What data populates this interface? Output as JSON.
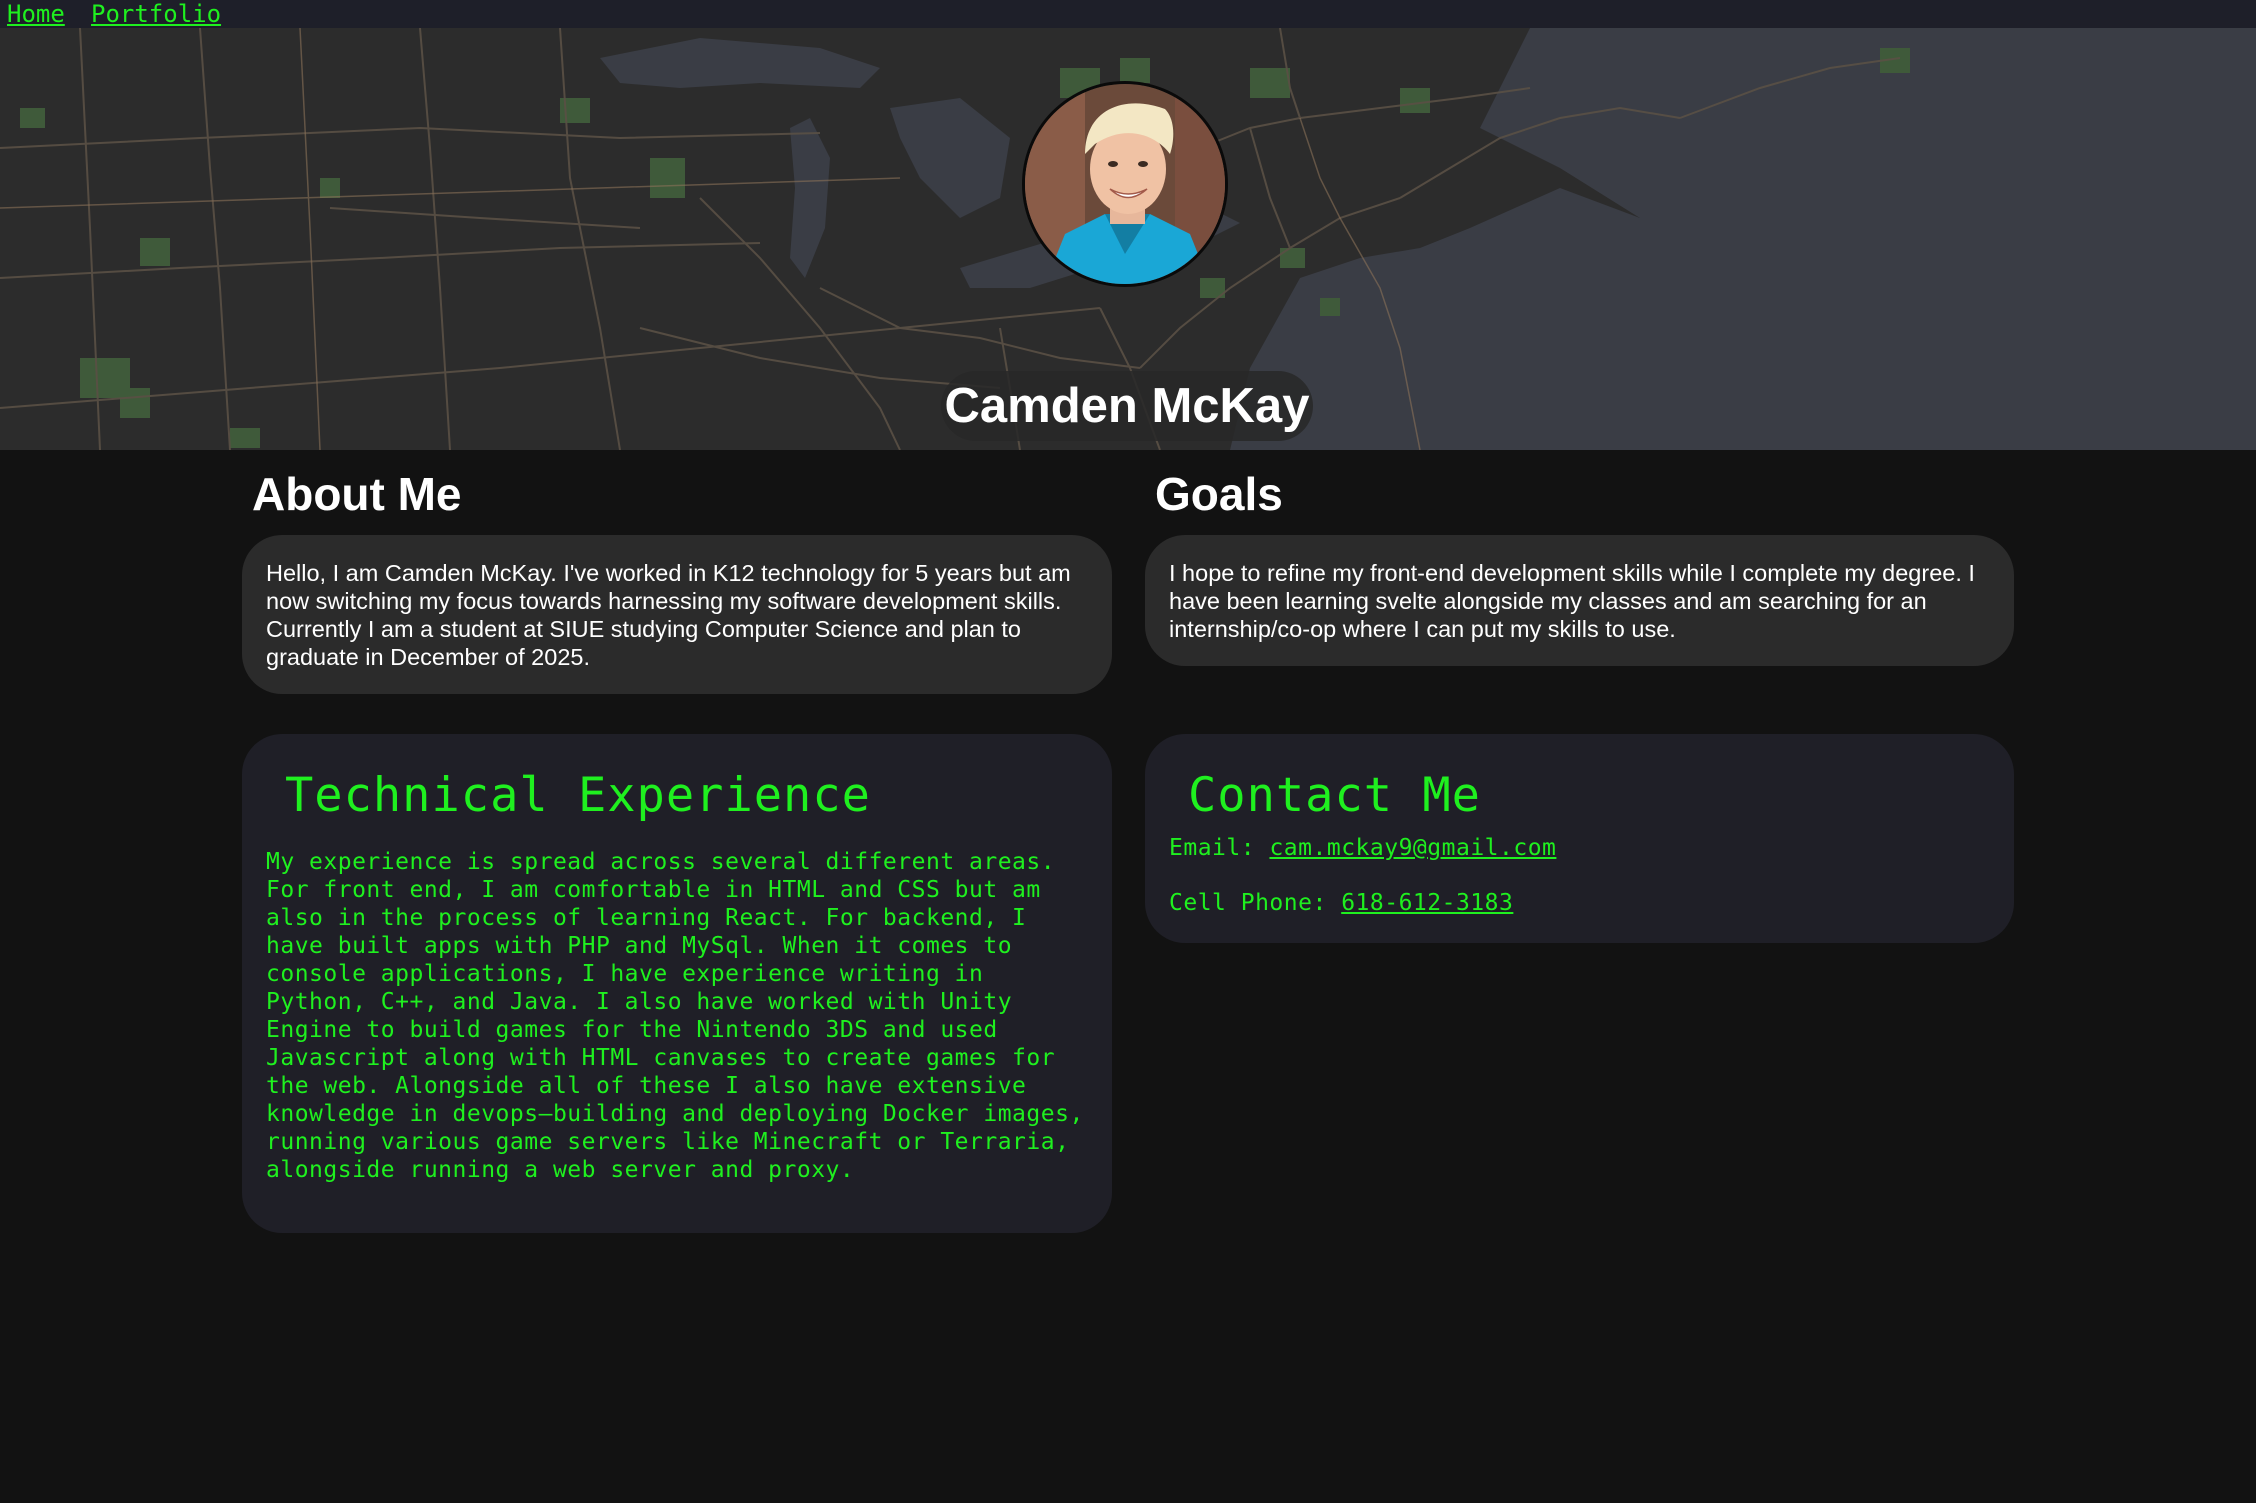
{
  "nav": {
    "home_label": "Home",
    "portfolio_label": "Portfolio"
  },
  "hero": {
    "name": "Camden McKay",
    "background": "map"
  },
  "about": {
    "heading": "About Me",
    "text": "Hello, I am Camden McKay. I've worked in K12 technology for 5 years but am now switching my focus towards harnessing my software development skills. Currently I am a student at SIUE studying Computer Science and plan to graduate in December of 2025."
  },
  "goals": {
    "heading": "Goals",
    "text": "I hope to refine my front-end development skills while I complete my degree. I have been learning svelte alongside my classes and am searching for an internship/co-op where I can put my skills to use."
  },
  "technical": {
    "heading": "Technical Experience",
    "text": "My experience is spread across several different areas. For front end, I am comfortable in HTML and CSS but am also in the process of learning React. For backend, I have built apps with PHP and MySql. When it comes to console applications, I have experience writing in Python, C++, and Java. I also have worked with Unity Engine to build games for the Nintendo 3DS and used Javascript along with HTML canvases to create games for the web. Alongside all of these I also have extensive knowledge in devops—building and deploying Docker images, running various game servers like Minecraft or Terraria, alongside running a web server and proxy."
  },
  "contact": {
    "heading": "Contact Me",
    "email_label": "Email:",
    "email_value": "cam.mckay9@gmail.com",
    "phone_label": "Cell Phone:",
    "phone_value": "618-612-3183"
  },
  "colors": {
    "accent_green": "#1ff01f",
    "page_background": "#121212",
    "nav_background": "#1e1f29",
    "card_light": "#2b2b2b",
    "card_dark": "#1f1f27"
  }
}
